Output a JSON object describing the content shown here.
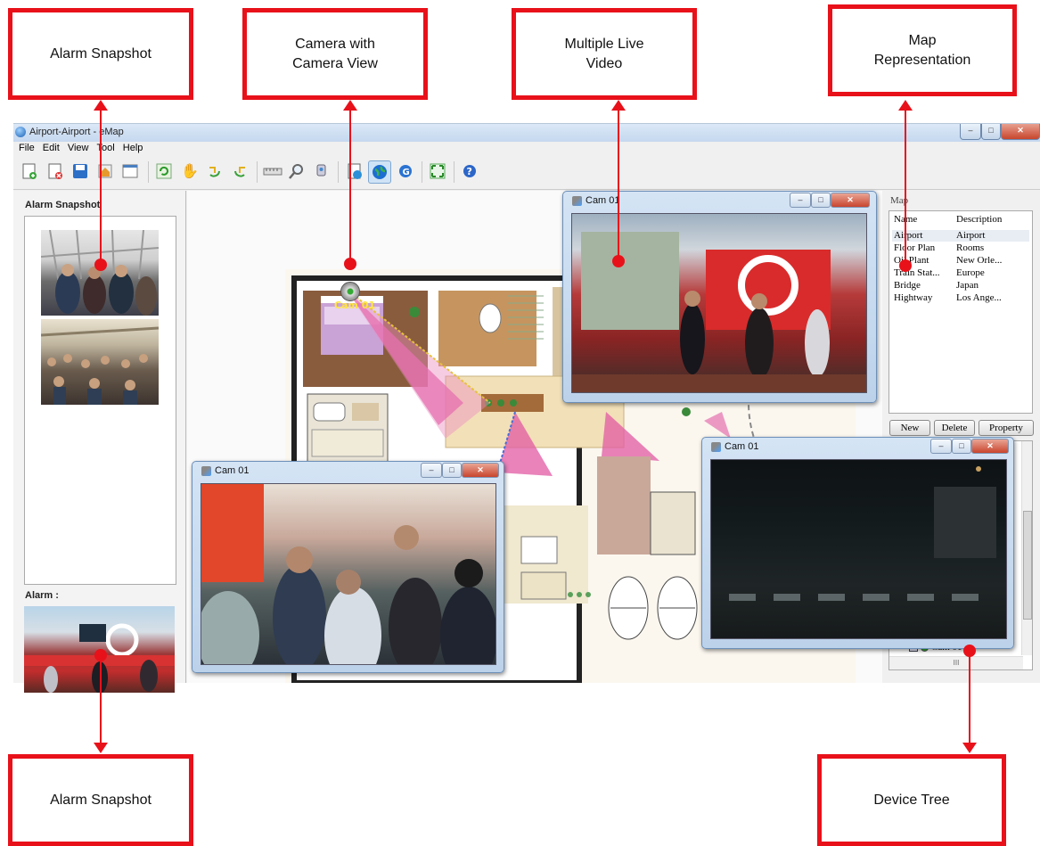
{
  "callouts": {
    "alarm_snapshot_top": "Alarm Snapshot",
    "camera_view": "Camera with Camera View",
    "multiple_live_video": "Multiple Live Video",
    "map_representation": "Map Representation",
    "alarm_snapshot_bottom": "Alarm Snapshot",
    "device_tree": "Device Tree"
  },
  "window": {
    "title": "Airport-Airport - eMap",
    "minimize": "–",
    "maximize": "□",
    "close": "✕"
  },
  "menu": [
    "File",
    "Edit",
    "View",
    "Tool",
    "Help"
  ],
  "toolbar_icons": [
    "new-map-icon",
    "delete-map-icon",
    "save-icon",
    "home-icon",
    "window-icon",
    "refresh-icon",
    "hand-icon",
    "rotate-left-icon",
    "rotate-right-icon",
    "ruler-icon",
    "zoom-icon",
    "camera-add-icon",
    "import-icon",
    "globe-icon",
    "google-icon",
    "fullscreen-icon",
    "help-icon"
  ],
  "left_panel": {
    "snapshot_title": "Alarm Snapshot",
    "alarm_title": "Alarm :"
  },
  "map_view": {
    "camera_label": "Cam 01"
  },
  "right_panel": {
    "map_title": "Map",
    "columns": [
      "Name",
      "Description"
    ],
    "rows": [
      {
        "name": "Airport",
        "description": "Airport"
      },
      {
        "name": "Floor Plan",
        "description": "Rooms"
      },
      {
        "name": "Oil Plant",
        "description": "New Orle..."
      },
      {
        "name": "Train Stat...",
        "description": "Europe"
      },
      {
        "name": "Bridge",
        "description": "Japan"
      },
      {
        "name": "Hightway",
        "description": "Los Ange..."
      }
    ],
    "buttons": {
      "new": "New",
      "delete": "Delete",
      "property": "Property"
    },
    "tree_item": "Cam 01",
    "scroll_mark": "III"
  },
  "cam_windows": [
    {
      "title": "Cam 01"
    },
    {
      "title": "Cam 01"
    },
    {
      "title": "Cam 01"
    }
  ]
}
